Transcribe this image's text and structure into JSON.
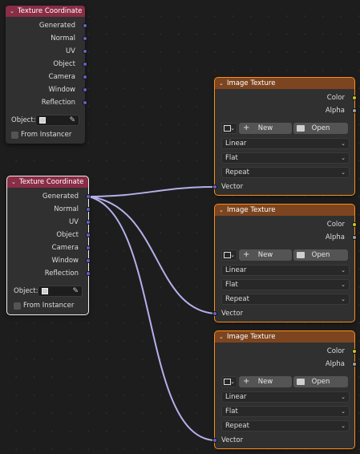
{
  "colors": {
    "canvas": "#1d1d1d",
    "node_body": "#303030",
    "texture_coordinate_header": "#8a2d46",
    "image_texture_header": "#7d451f",
    "vector_socket": "#6363c7",
    "color_socket": "#c7c729",
    "alpha_socket": "#a1a1a1",
    "link_wire": "#b4b0ea",
    "selection_outline": "#ff8c1a"
  },
  "nodes": {
    "coord_top": {
      "title": "Texture Coordinate",
      "outputs": [
        "Generated",
        "Normal",
        "UV",
        "Object",
        "Camera",
        "Window",
        "Reflection"
      ],
      "object_label": "Object:",
      "object_icon": "object-cube-icon",
      "picker_icon": "eyedropper-icon",
      "from_instancer_label": "From Instancer",
      "from_instancer_checked": false
    },
    "coord_selected": {
      "title": "Texture Coordinate",
      "outputs": [
        "Generated",
        "Normal",
        "UV",
        "Object",
        "Camera",
        "Window",
        "Reflection"
      ],
      "object_label": "Object:",
      "object_icon": "object-cube-icon",
      "picker_icon": "eyedropper-icon",
      "from_instancer_label": "From Instancer",
      "from_instancer_checked": false
    },
    "image_textures": [
      {
        "title": "Image Texture",
        "outputs": [
          "Color",
          "Alpha"
        ],
        "new_label": "New",
        "open_label": "Open",
        "interpolation": "Linear",
        "projection": "Flat",
        "extension": "Repeat",
        "input": "Vector"
      },
      {
        "title": "Image Texture",
        "outputs": [
          "Color",
          "Alpha"
        ],
        "new_label": "New",
        "open_label": "Open",
        "interpolation": "Linear",
        "projection": "Flat",
        "extension": "Repeat",
        "input": "Vector"
      },
      {
        "title": "Image Texture",
        "outputs": [
          "Color",
          "Alpha"
        ],
        "new_label": "New",
        "open_label": "Open",
        "interpolation": "Linear",
        "projection": "Flat",
        "extension": "Repeat",
        "input": "Vector"
      }
    ]
  },
  "icons": {
    "collapse": "chevron-down-icon",
    "add": "plus-icon",
    "open": "folder-icon",
    "image_type": "image-icon",
    "dropdown": "chevron-down-icon"
  },
  "glyphs": {
    "chevron": "⌄",
    "plus": "+",
    "picker": "✎"
  }
}
